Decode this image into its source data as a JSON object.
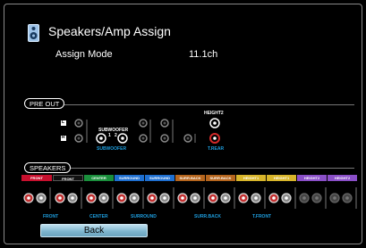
{
  "header": {
    "icon": "speaker-icon",
    "title": "Speakers/Amp Assign",
    "assign_mode_label": "Assign Mode",
    "assign_mode_value": "11.1ch"
  },
  "pre_out": {
    "tag": "PRE OUT",
    "left_label": "L",
    "right_label": "R",
    "subwoofer_label": "SUBWOOFER",
    "subwoofer_1": "1",
    "subwoofer_2": "2",
    "subwoofer_assign": "SUBWOOFER",
    "height2_label": "HEIGHT2",
    "trear_assign": "T.REAR"
  },
  "speakers": {
    "tag": "SPEAKERS",
    "channels": [
      {
        "label": "FRONT",
        "color": "#c8102e"
      },
      {
        "label": "FRONT",
        "color": "#111111"
      },
      {
        "label": "CENTER",
        "color": "#1a8f3c"
      },
      {
        "label": "SURROUND",
        "color": "#1e6fd0"
      },
      {
        "label": "SURROUND",
        "color": "#1e6fd0"
      },
      {
        "label": "SURR.BACK",
        "color": "#b5651d"
      },
      {
        "label": "SURR.BACK",
        "color": "#b5651d"
      },
      {
        "label": "HEIGHT1",
        "color": "#d8b52a"
      },
      {
        "label": "HEIGHT1",
        "color": "#d8b52a"
      },
      {
        "label": "HEIGHT2",
        "color": "#8a4fc8"
      },
      {
        "label": "HEIGHT2",
        "color": "#8a4fc8"
      }
    ],
    "assign_labels": [
      "FRONT",
      "CENTER",
      "SURROUND",
      "SURR.BACK",
      "T.FRONT"
    ]
  },
  "footer": {
    "back_label": "Back"
  }
}
